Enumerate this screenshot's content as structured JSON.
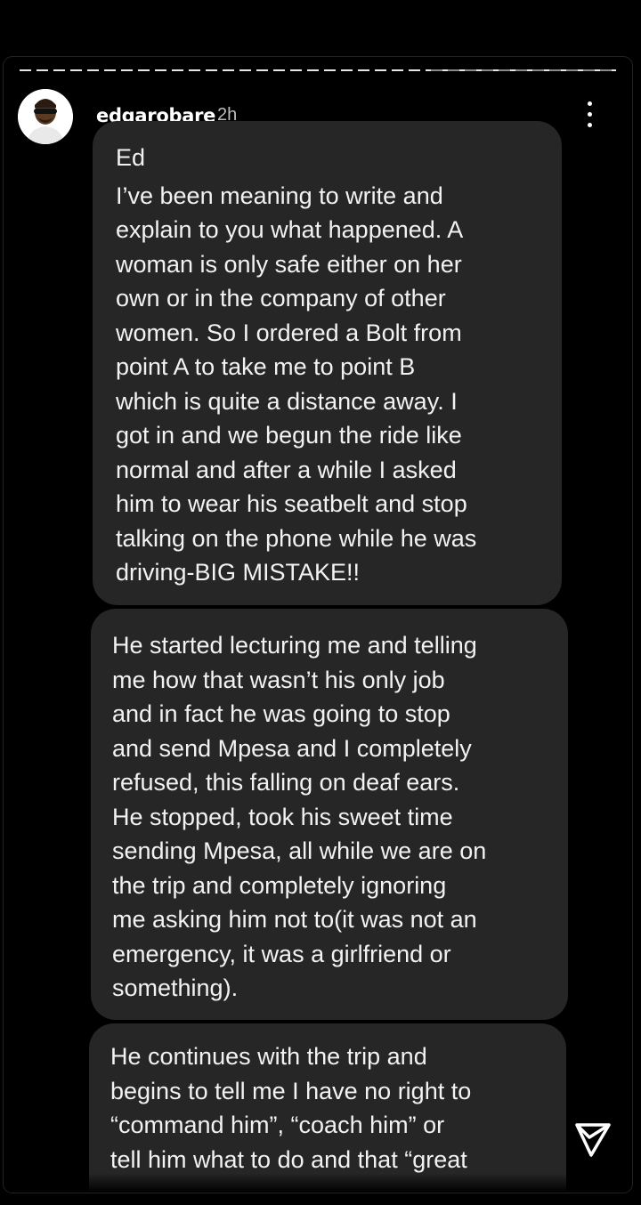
{
  "story": {
    "username": "edgarobare",
    "time_ago": "2h",
    "icons": {
      "avatar": "avatar",
      "more": "more-vertical-icon",
      "send": "send-icon"
    },
    "progress_viewed_fraction": 0.69
  },
  "messages": [
    {
      "greeting": "Ed",
      "lines": [
        "I’ve been meaning to write and",
        "explain to you what happened. A",
        "woman is only safe either on her",
        "own or in the company of other",
        "women. So I ordered a Bolt from",
        "point A to take me to point B",
        "which is quite a distance away. I",
        "got in and we begun the ride like",
        "normal and after a while I asked",
        "him to wear his seatbelt and stop",
        "talking on the phone while he was",
        "driving-BIG MISTAKE!!"
      ]
    },
    {
      "lines": [
        "He started lecturing me and telling",
        "me how that wasn’t his only job",
        "and in fact he was going to  stop",
        "and send Mpesa and I completely",
        "refused, this falling on deaf ears.",
        "He stopped, took his sweet time",
        "sending Mpesa, all while we are on",
        "the trip and completely ignoring",
        "me asking him not to(it was not an",
        "emergency, it was a girlfriend or",
        "something)."
      ]
    },
    {
      "lines": [
        "He continues with the trip and",
        "begins to tell me I have no right to",
        "“command him”, “coach him” or",
        "tell him what to do and that “great"
      ]
    }
  ]
}
